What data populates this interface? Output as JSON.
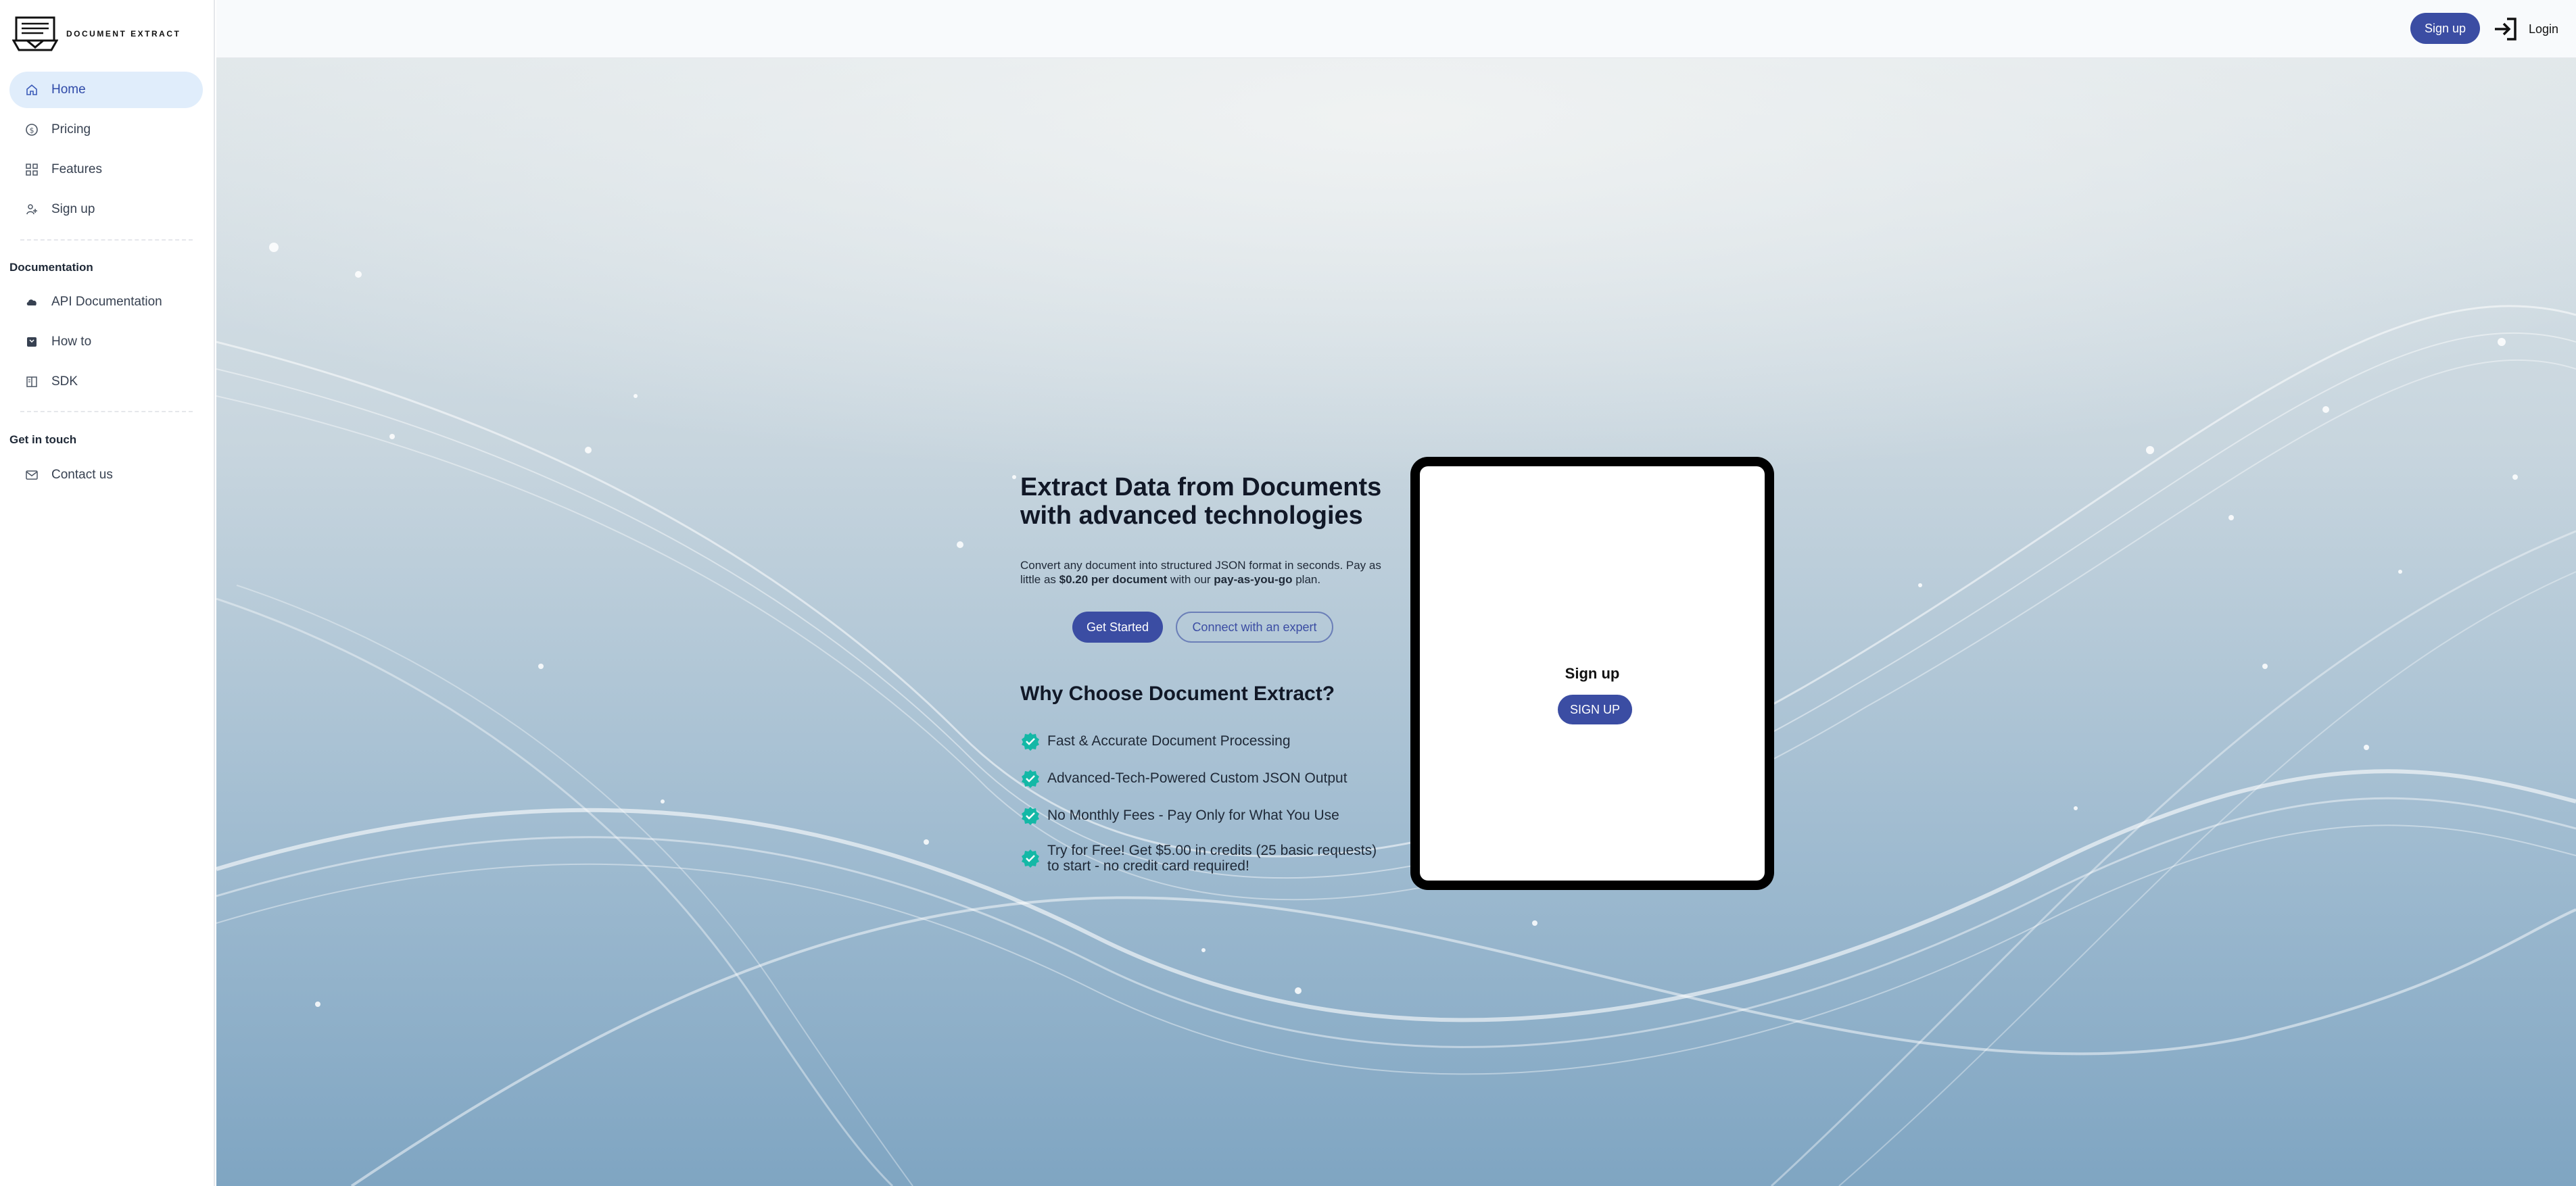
{
  "brand": {
    "name": "DOCUMENT EXTRACT"
  },
  "sidebar": {
    "main_items": [
      {
        "label": "Home",
        "icon": "home-icon",
        "active": true
      },
      {
        "label": "Pricing",
        "icon": "dollar-circle-icon"
      },
      {
        "label": "Features",
        "icon": "grid-icon"
      },
      {
        "label": "Sign up",
        "icon": "person-add-icon"
      }
    ],
    "documentation_title": "Documentation",
    "documentation_items": [
      {
        "label": "API Documentation",
        "icon": "cloud-icon"
      },
      {
        "label": "How to",
        "icon": "book-icon"
      },
      {
        "label": "SDK",
        "icon": "book-open-icon"
      }
    ],
    "contact_title": "Get in touch",
    "contact_items": [
      {
        "label": "Contact us",
        "icon": "mail-icon"
      }
    ]
  },
  "topbar": {
    "signup_label": "Sign up",
    "login_label": "Login",
    "login_icon": "login-icon"
  },
  "hero": {
    "headline": "Extract Data from Documents with advanced technologies",
    "desc_part1": "Convert any document into structured JSON format in seconds. Pay as little as ",
    "desc_price": "$0.20 per document",
    "desc_part2": " with our ",
    "desc_plan": "pay-as-you-go",
    "desc_part3": " plan.",
    "get_started_label": "Get Started",
    "expert_label": "Connect with an expert",
    "why_title": "Why Choose Document Extract?",
    "features": [
      "Fast & Accurate Document Processing",
      "Advanced-Tech-Powered Custom JSON Output",
      "No Monthly Fees - Pay Only for What You Use",
      "Try for Free! Get $5.00 in credits (25 basic requests) to start - no credit card required!"
    ]
  },
  "card": {
    "title": "Sign up",
    "button_label": "SIGN UP"
  },
  "colors": {
    "accent": "#3b4da3",
    "active_bg": "#e0edfb",
    "check": "#14b8a6"
  }
}
